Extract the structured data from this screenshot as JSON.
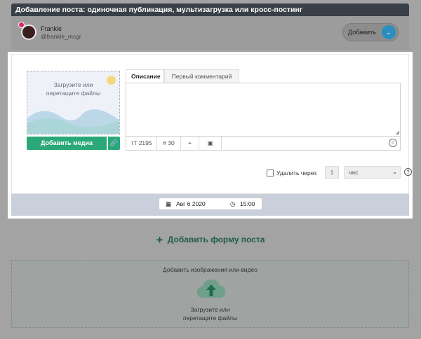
{
  "header": {
    "title": "Добавление поста: одиночная публикация, мультизагрузка или кросс-постинг"
  },
  "profile": {
    "name": "Frankie",
    "handle": "@frankie_mcgr",
    "add_label": "Добавить",
    "add_caret": "⌄"
  },
  "media": {
    "drop_line1": "Загрузите или",
    "drop_line2": "перетащите файлы",
    "add_media_label": "Добавить медиа",
    "link_icon": "🔗"
  },
  "tabs": [
    {
      "label": "Описание"
    },
    {
      "label": "Первый комментарий"
    }
  ],
  "editor": {
    "text_value": "",
    "char_icon": "тT",
    "char_count": "2195",
    "hash_icon": "#",
    "hash_count": "30",
    "location_icon": "⌖",
    "gallery_icon": "▣",
    "emoji_icon": "☺"
  },
  "delete": {
    "label": "Удалить через",
    "value": "1",
    "unit": "час",
    "caret": "⌄",
    "help": "?"
  },
  "schedule": {
    "date_icon": "▦",
    "date": "Авг 6 2020",
    "time_icon": "◷",
    "time": "15:00"
  },
  "add_form": {
    "plus": "+",
    "label": "Добавить форму поста"
  },
  "upload": {
    "title": "Добавить изображения или видео",
    "line1": "Загрузите или",
    "line2": "перетащите файлы"
  },
  "colors": {
    "accent": "#2aa877",
    "topbar": "#3a4048",
    "blue": "#2a8fc0"
  }
}
